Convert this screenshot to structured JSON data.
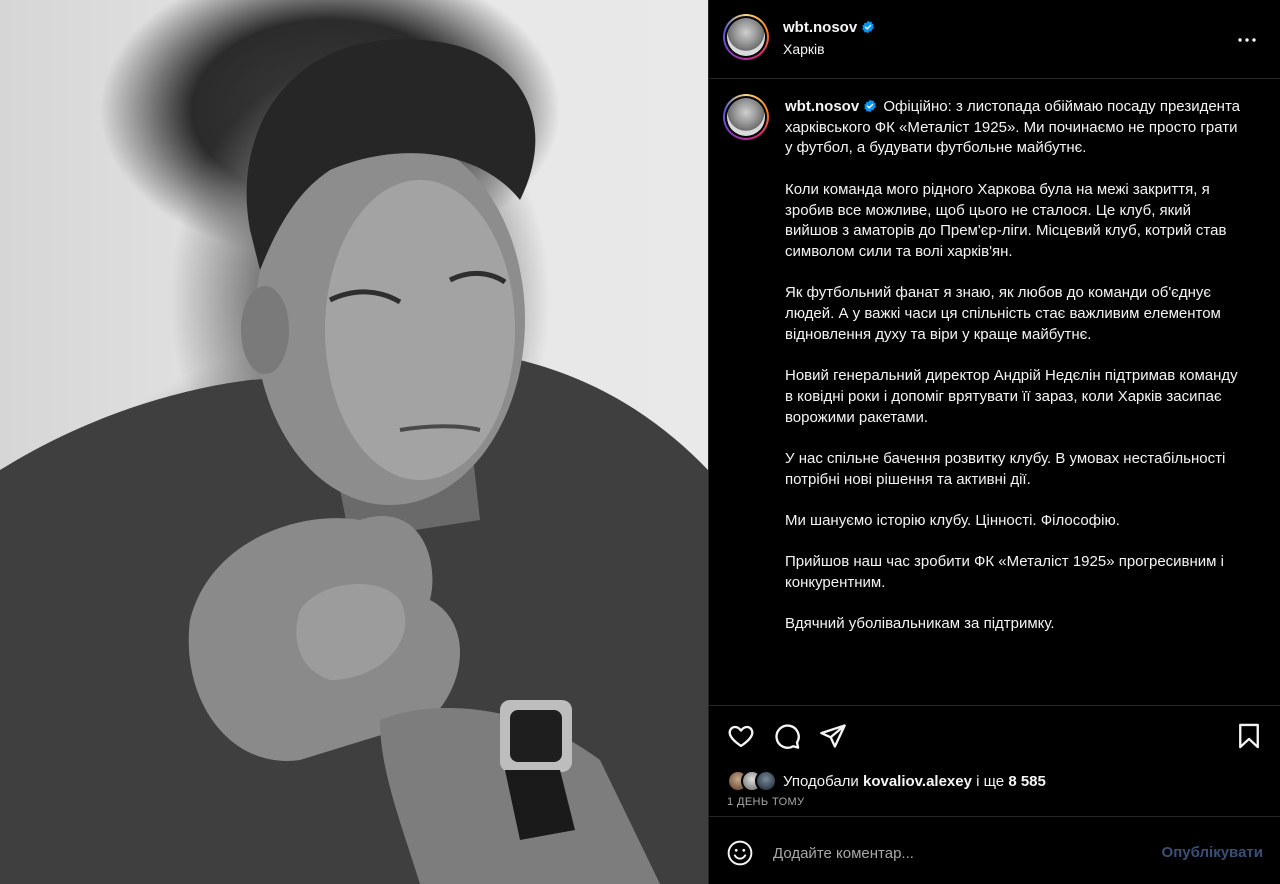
{
  "post": {
    "username": "wbt.nosov",
    "location": "Харків",
    "verified": true,
    "caption_paragraphs": [
      "Офіційно: з листопада обіймаю посаду президента харківського ФК «Металіст 1925». Ми починаємо не просто грати у футбол, а будувати футбольне майбутнє.",
      "Коли команда мого рідного Харкова була на межі закриття, я зробив все можливе, щоб цього не сталося. Це клуб, який вийшов з аматорів до Прем'єр-ліги. Місцевий клуб, котрий став символом сили та волі харків'ян.",
      "Як футбольний фанат я знаю, як любов до команди об'єднує людей. А у важкі часи ця спільність стає важливим елементом відновлення духу та віри у краще майбутнє.",
      "Новий генеральний директор Андрій Недєлін підтримав команду в ковідні роки і допоміг врятувати її зараз, коли Харків засипає ворожими ракетами.",
      "У нас спільне бачення розвитку клубу. В умовах нестабільності потрібні нові рішення та активні дії.",
      "Ми шануємо історію клубу. Цінності. Філософію.",
      "Прийшов наш час зробити ФК «Металіст 1925» прогресивним і конкурентним.",
      "Вдячний уболівальникам за підтримку."
    ]
  },
  "likes": {
    "prefix": "Уподобали",
    "user": "kovaliov.alexey",
    "middle": "і ще",
    "count": "8 585"
  },
  "time_ago": "1 ДЕНЬ ТОМУ",
  "comment": {
    "placeholder": "Додайте коментар...",
    "publish_label": "Опублікувати"
  },
  "icons": [
    "more-icon",
    "heart-icon",
    "comment-icon",
    "share-icon",
    "bookmark-icon",
    "emoji-icon",
    "verified-icon"
  ],
  "colors": {
    "background": "#000000",
    "text": "#f5f5f5",
    "muted": "#a8a8a8",
    "verified": "#0095f6",
    "publish_disabled": "#385077",
    "divider": "#262626"
  }
}
